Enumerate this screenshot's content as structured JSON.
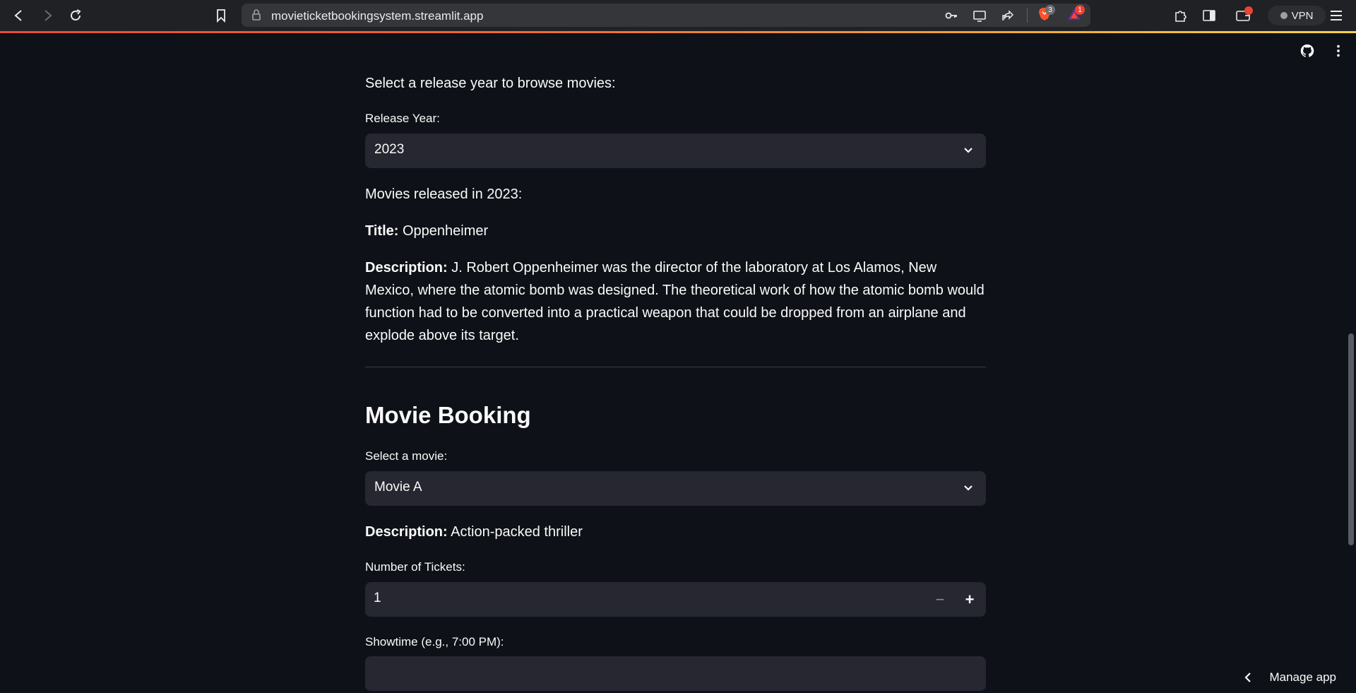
{
  "browser": {
    "url": "movieticketbookingsystem.streamlit.app",
    "brave_badge": "3",
    "alert_badge": "1",
    "vpn_label": "VPN"
  },
  "browse": {
    "intro": "Select a release year to browse movies:",
    "year_label": "Release Year:",
    "year_value": "2023",
    "movies_heading": "Movies released in 2023:",
    "title_label": "Title:",
    "title_value": "Oppenheimer",
    "description_label": "Description:",
    "description_value": "J. Robert Oppenheimer was the director of the laboratory at Los Alamos, New Mexico, where the atomic bomb was designed. The theoretical work of how the atomic bomb would function had to be converted into a practical weapon that could be dropped from an airplane and explode above its target."
  },
  "booking": {
    "heading": "Movie Booking",
    "movie_label": "Select a movie:",
    "movie_value": "Movie A",
    "description_label": "Description:",
    "description_value": "Action-packed thriller",
    "tickets_label": "Number of Tickets:",
    "tickets_value": "1",
    "minus_symbol": "−",
    "plus_symbol": "+",
    "showtime_label": "Showtime (e.g., 7:00 PM):",
    "showtime_value": ""
  },
  "footer": {
    "manage_app": "Manage app"
  },
  "colors": {
    "background": "#0e1117",
    "input_bg": "#262730",
    "text": "#fafafa"
  }
}
